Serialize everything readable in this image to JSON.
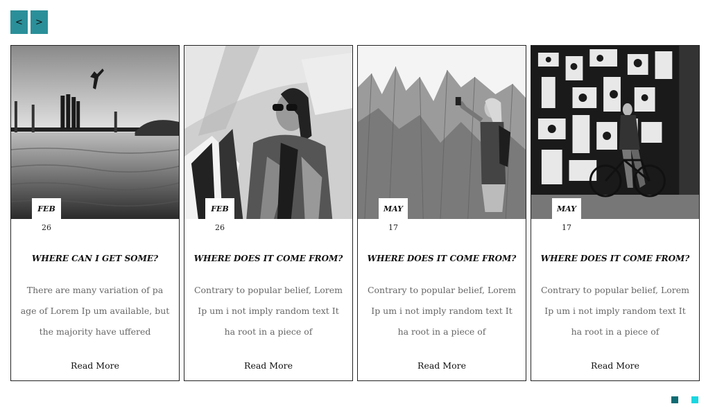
{
  "nav": {
    "prev_label": "<",
    "next_label": ">"
  },
  "cards": [
    {
      "image": "lake-jump-photo",
      "month": "FEB",
      "day": "26",
      "title": "WHERE CAN I GET SOME?",
      "text": "There are many variation of pa age of Lorem Ip um available, but the majority have uffered",
      "link": "Read More"
    },
    {
      "image": "sunglasses-woman-photo",
      "month": "FEB",
      "day": "26",
      "title": "WHERE DOES IT COME FROM?",
      "text": "Contrary to popular belief, Lorem Ip um i not imply random text It ha root in a piece of",
      "link": "Read More"
    },
    {
      "image": "mountain-selfie-photo",
      "month": "MAY",
      "day": "17",
      "title": "WHERE DOES IT COME FROM?",
      "text": "Contrary to popular belief, Lorem Ip um i not imply random text It ha root in a piece of",
      "link": "Read More"
    },
    {
      "image": "graffiti-bicycle-photo",
      "month": "MAY",
      "day": "17",
      "title": "WHERE DOES IT COME FROM?",
      "text": "Contrary to popular belief, Lorem Ip um i not imply random text It ha root in a piece of",
      "link": "Read More"
    }
  ],
  "colors": {
    "accent": "#2a8f99",
    "dot_active": "#0e6b72",
    "dot_inactive": "#1ad6e0"
  }
}
